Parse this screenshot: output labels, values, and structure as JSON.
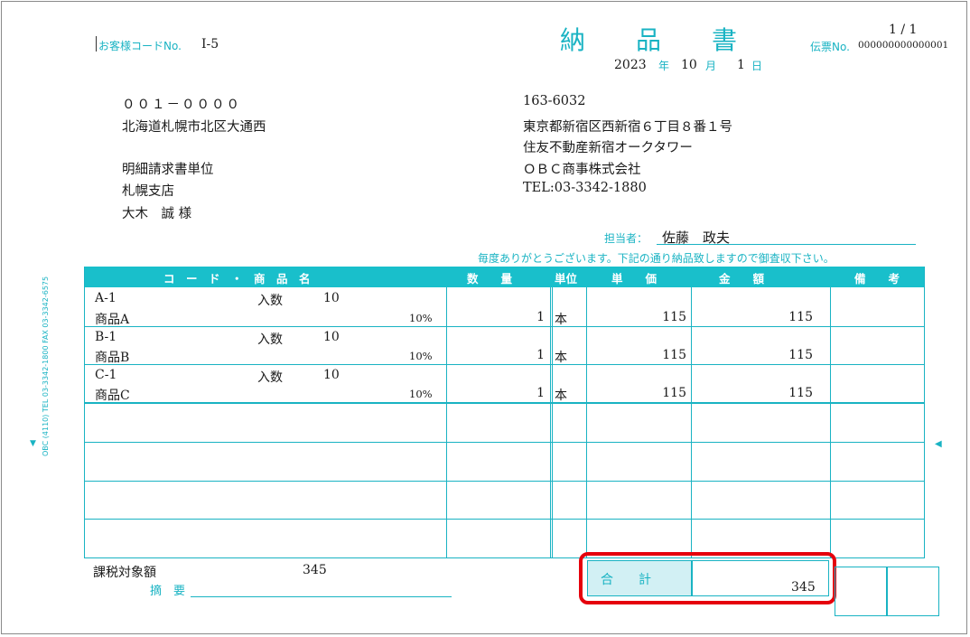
{
  "header": {
    "customer_code_label": "お客様コードNo.",
    "customer_code": "I-5",
    "title": "納　　品　　書",
    "page": "1 / 1",
    "slip_label": "伝票No.",
    "slip_no": "000000000000001",
    "date_year": "2023",
    "date_year_unit": "年",
    "date_month": "10",
    "date_month_unit": "月",
    "date_day": "1",
    "date_day_unit": "日"
  },
  "customer": {
    "postal": "００１－００００",
    "address": "北海道札幌市北区大通西",
    "dept": "明細請求書単位",
    "branch": "札幌支店",
    "name": "大木　誠 様"
  },
  "sender": {
    "postal": "163-6032",
    "address1": "東京都新宿区西新宿６丁目８番１号",
    "address2": "住友不動産新宿オークタワー",
    "company": "ＯＢＣ商事株式会社",
    "tel": "TEL:03-3342-1880"
  },
  "staff": {
    "label": "担当者：",
    "name": "佐藤　政夫"
  },
  "message": "毎度ありがとうございます。下記の通り納品致しますので御査収下さい。",
  "table": {
    "headers": {
      "code_name": "コ　ー　ド　・　商　品　名",
      "qty": "数　　量",
      "unit": "単位",
      "price": "単　　価",
      "amount": "金　　額",
      "note": "備　　考"
    },
    "rows": [
      {
        "code": "A-1",
        "irisu_label": "入数",
        "irisu": "10",
        "name": "商品A",
        "tax": "10%",
        "qty": "1",
        "unit": "本",
        "price": "115",
        "amount": "115"
      },
      {
        "code": "B-1",
        "irisu_label": "入数",
        "irisu": "10",
        "name": "商品B",
        "tax": "10%",
        "qty": "1",
        "unit": "本",
        "price": "115",
        "amount": "115"
      },
      {
        "code": "C-1",
        "irisu_label": "入数",
        "irisu": "10",
        "name": "商品C",
        "tax": "10%",
        "qty": "1",
        "unit": "本",
        "price": "115",
        "amount": "115"
      }
    ]
  },
  "footer": {
    "taxable_label": "課税対象額",
    "taxable_value": "345",
    "memo_label": "摘　要",
    "total_label": "合　　計",
    "total_value": "345"
  },
  "side_text": {
    "left_vertical": "OBC (4110) TEL 03-3342-1800 FAX 03-3342-6575"
  },
  "colors": {
    "accent": "#19b3c3",
    "highlight": "#e5000c"
  }
}
